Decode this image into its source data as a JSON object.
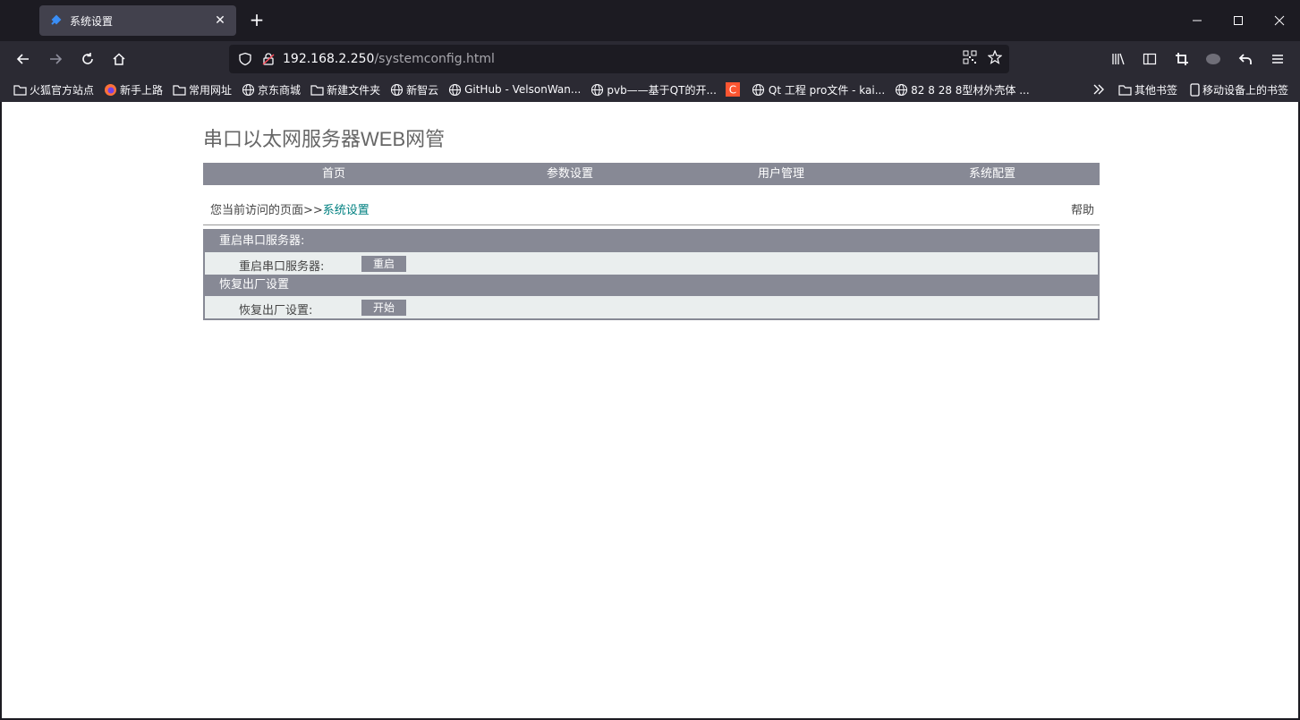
{
  "browser": {
    "tab_title": "系统设置",
    "url_host": "192.168.2.250",
    "url_path": "/systemconfig.html"
  },
  "bookmarks": [
    {
      "icon": "folder-icon",
      "label": "火狐官方站点"
    },
    {
      "icon": "firefox-icon",
      "label": "新手上路"
    },
    {
      "icon": "folder-icon",
      "label": "常用网址"
    },
    {
      "icon": "globe-icon",
      "label": "京东商城"
    },
    {
      "icon": "folder-icon",
      "label": "新建文件夹"
    },
    {
      "icon": "globe-icon",
      "label": "新智云"
    },
    {
      "icon": "globe-icon",
      "label": "GitHub - VelsonWan..."
    },
    {
      "icon": "globe-icon",
      "label": "pvb——基于QT的开..."
    },
    {
      "icon": "csdn-icon",
      "label": ""
    },
    {
      "icon": "globe-icon",
      "label": "Qt 工程 pro文件 - kai..."
    },
    {
      "icon": "globe-icon",
      "label": "82 8 28 8型材外壳体 ..."
    }
  ],
  "bookmarks_right": {
    "other": "其他书签",
    "mobile": "移动设备上的书签"
  },
  "site": {
    "title": "串口以太网服务器WEB网管",
    "nav": [
      "首页",
      "参数设置",
      "用户管理",
      "系统配置"
    ],
    "breadcrumb_prefix": "您当前访问的页面>>",
    "breadcrumb_current": "系统设置",
    "help": "帮助"
  },
  "sections": [
    {
      "heading": "重启串口服务器:",
      "row_label": "重启串口服务器:",
      "button": "重启"
    },
    {
      "heading": "恢复出厂设置",
      "row_label": "恢复出厂设置:",
      "button": "开始"
    }
  ],
  "colors": {
    "nav_bg": "#878995",
    "row_bg": "#eaeeee",
    "breadcrumb_current": "#008080"
  }
}
